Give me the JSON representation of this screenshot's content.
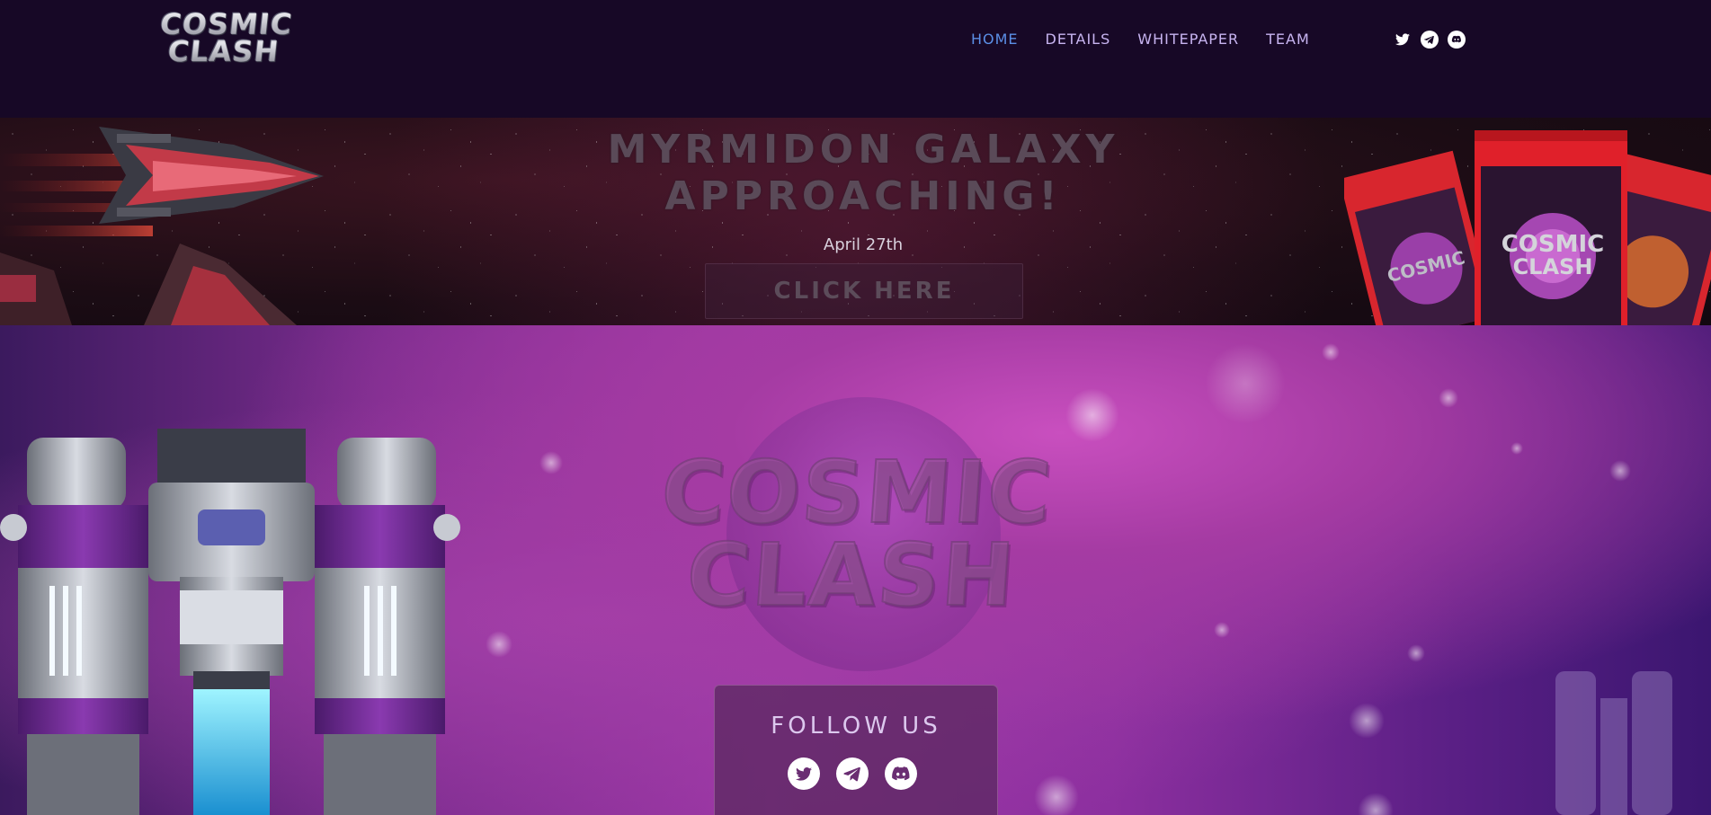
{
  "header": {
    "logo_line1": "COSMIC",
    "logo_line2": "CLASH",
    "nav": [
      {
        "label": "HOME",
        "active": true
      },
      {
        "label": "DETAILS",
        "active": false
      },
      {
        "label": "WHITEPAPER",
        "active": false
      },
      {
        "label": "TEAM",
        "active": false
      }
    ],
    "social": [
      "twitter-icon",
      "telegram-icon",
      "discord-icon"
    ]
  },
  "banner": {
    "headline_line1": "MYRMIDON GALAXY",
    "headline_line2": "APPROACHING!",
    "date": "April 27th",
    "cta_label": "CLICK HERE"
  },
  "hero": {
    "logo_line1": "COSMIC",
    "logo_line2": "CLASH",
    "follow_title": "FOLLOW US",
    "social": [
      "twitter-icon",
      "telegram-icon",
      "discord-icon"
    ]
  },
  "colors": {
    "background": "#170826",
    "nav_text": "#c7b4f0",
    "nav_active": "#5b8fe6",
    "hero_magenta": "#c94fbf"
  }
}
